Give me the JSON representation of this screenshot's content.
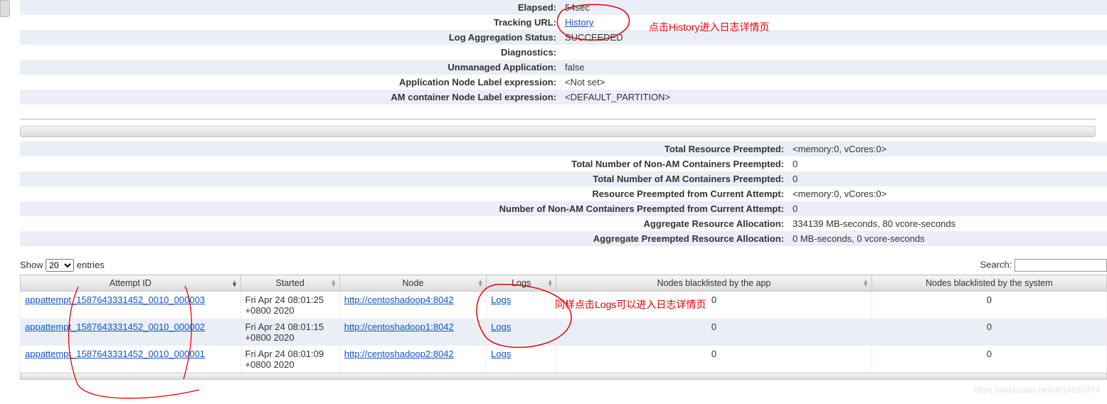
{
  "info": {
    "rows": [
      {
        "label": "Elapsed:",
        "value": "54sec",
        "link": false
      },
      {
        "label": "Tracking URL:",
        "value": "History",
        "link": true
      },
      {
        "label": "Log Aggregation Status:",
        "value": "SUCCEEDED",
        "link": false
      },
      {
        "label": "Diagnostics:",
        "value": "",
        "link": false
      },
      {
        "label": "Unmanaged Application:",
        "value": "false",
        "link": false
      },
      {
        "label": "Application Node Label expression:",
        "value": "<Not set>",
        "link": false
      },
      {
        "label": "AM container Node Label expression:",
        "value": "<DEFAULT_PARTITION>",
        "link": false
      }
    ]
  },
  "preempt": {
    "rows": [
      {
        "label": "Total Resource Preempted:",
        "value": "<memory:0, vCores:0>"
      },
      {
        "label": "Total Number of Non-AM Containers Preempted:",
        "value": "0"
      },
      {
        "label": "Total Number of AM Containers Preempted:",
        "value": "0"
      },
      {
        "label": "Resource Preempted from Current Attempt:",
        "value": "<memory:0, vCores:0>"
      },
      {
        "label": "Number of Non-AM Containers Preempted from Current Attempt:",
        "value": "0"
      },
      {
        "label": "Aggregate Resource Allocation:",
        "value": "334139 MB-seconds, 80 vcore-seconds"
      },
      {
        "label": "Aggregate Preempted Resource Allocation:",
        "value": "0 MB-seconds, 0 vcore-seconds"
      }
    ]
  },
  "controls": {
    "show_label": "Show",
    "entries_label": "entries",
    "page_size": "20",
    "search_label": "Search:",
    "search_value": ""
  },
  "columns": {
    "attempt": "Attempt ID",
    "started": "Started",
    "node": "Node",
    "logs": "Logs",
    "black_app": "Nodes blacklisted by the app",
    "black_sys": "Nodes blacklisted by the system"
  },
  "attempts": [
    {
      "id": "appattempt_1587643331452_0010_000003",
      "started": "Fri Apr 24 08:01:25 +0800 2020",
      "node": "http://centoshadoop4:8042",
      "logs": "Logs",
      "black_app": "0",
      "black_sys": "0"
    },
    {
      "id": "appattempt_1587643331452_0010_000002",
      "started": "Fri Apr 24 08:01:15 +0800 2020",
      "node": "http://centoshadoop1:8042",
      "logs": "Logs",
      "black_app": "0",
      "black_sys": "0"
    },
    {
      "id": "appattempt_1587643331452_0010_000001",
      "started": "Fri Apr 24 08:01:09 +0800 2020",
      "node": "http://centoshadoop2:8042",
      "logs": "Logs",
      "black_app": "0",
      "black_sys": "0"
    }
  ],
  "annotations": {
    "history_note": "点击History进入日志详情页",
    "logs_note": "同样点击Logs可以进入日志详情页"
  },
  "watermark": "https://blog.csdn.net/u014635374"
}
